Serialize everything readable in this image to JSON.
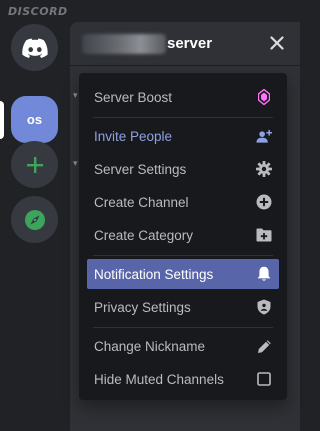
{
  "app": {
    "wordmark": "DISCORD"
  },
  "rail": {
    "items": [
      {
        "name": "home",
        "icon": "discord-logo-icon"
      },
      {
        "name": "server",
        "label": "os",
        "selected": true
      },
      {
        "name": "add-server",
        "icon": "plus-icon"
      },
      {
        "name": "explore",
        "icon": "compass-icon"
      }
    ]
  },
  "header": {
    "server_name": "server",
    "close_icon": "close-icon"
  },
  "menu": {
    "items": [
      {
        "label": "Server Boost",
        "icon": "boost-gem-icon"
      },
      {
        "label": "Invite People",
        "icon": "add-person-icon"
      },
      {
        "label": "Server Settings",
        "icon": "gear-icon"
      },
      {
        "label": "Create Channel",
        "icon": "plus-circle-icon"
      },
      {
        "label": "Create Category",
        "icon": "folder-plus-icon"
      },
      {
        "label": "Notification Settings",
        "icon": "bell-icon",
        "highlighted": true
      },
      {
        "label": "Privacy Settings",
        "icon": "shield-icon"
      },
      {
        "label": "Change Nickname",
        "icon": "pencil-icon"
      },
      {
        "label": "Hide Muted Channels",
        "icon": "checkbox-icon",
        "checked": false
      }
    ]
  },
  "colors": {
    "accent": "#7289da",
    "highlight": "#5865a8",
    "invite": "#8ea1e1",
    "boost": "#ff73fa",
    "add_green": "#3ba55d"
  }
}
